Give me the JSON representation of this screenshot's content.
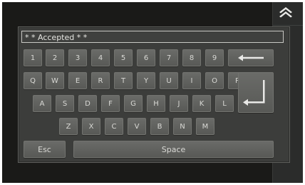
{
  "input": {
    "value": "* * Accepted * *"
  },
  "keyboard": {
    "row1": [
      "1",
      "2",
      "3",
      "4",
      "5",
      "6",
      "7",
      "8",
      "9"
    ],
    "row2": [
      "Q",
      "W",
      "E",
      "R",
      "T",
      "Y",
      "U",
      "I",
      "O",
      "P"
    ],
    "row3": [
      "A",
      "S",
      "D",
      "F",
      "G",
      "H",
      "J",
      "K",
      "L"
    ],
    "row4": [
      "Z",
      "X",
      "C",
      "V",
      "B",
      "N",
      "M"
    ],
    "esc_label": "Esc",
    "space_label": "Space"
  },
  "icons": {
    "backspace": "left-arrow-icon",
    "enter": "enter-return-icon",
    "scroll_up": "double-chevron-up-icon"
  },
  "colors": {
    "panel": "#3c3d3b",
    "key": "#62635f",
    "key_text": "#d8d8d4",
    "background": "#1a1a18"
  }
}
